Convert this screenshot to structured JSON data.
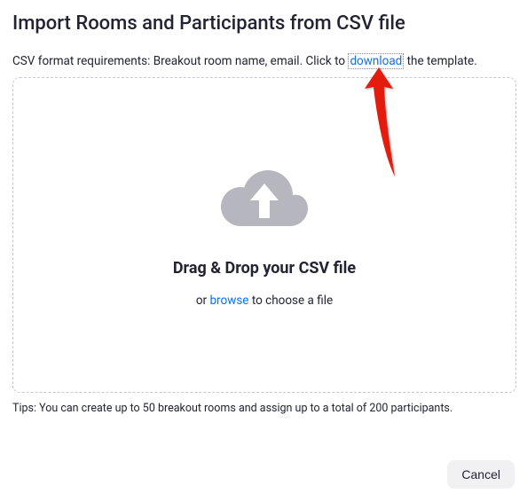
{
  "header": {
    "title": "Import Rooms and Participants from CSV file"
  },
  "subtitle": {
    "prefix": "CSV format requirements: Breakout room name, email. Click to ",
    "link_text": "download",
    "suffix": " the template."
  },
  "dropzone": {
    "heading": "Drag & Drop your CSV file",
    "or_text": "or ",
    "browse_text": "browse",
    "suffix_text": " to choose a file"
  },
  "tips": "Tips: You can create up to 50 breakout rooms and assign up to a total of 200 participants.",
  "buttons": {
    "cancel": "Cancel"
  },
  "icons": {
    "cloud_upload": "cloud-upload-icon"
  },
  "annotation": {
    "arrow_color": "#e31b0c"
  }
}
